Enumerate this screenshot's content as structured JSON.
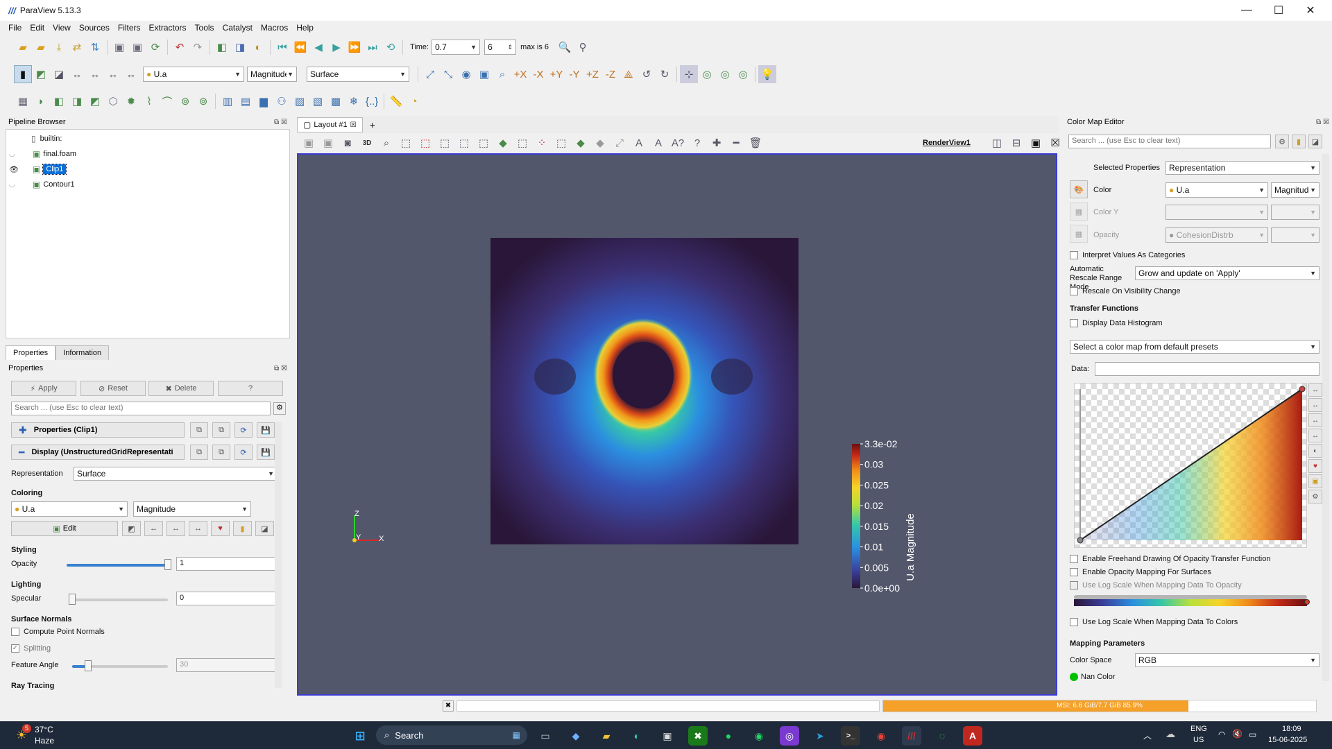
{
  "app": {
    "title": "ParaView 5.13.3",
    "logo": "paraview-logo"
  },
  "menu": [
    "File",
    "Edit",
    "View",
    "Sources",
    "Filters",
    "Extractors",
    "Tools",
    "Catalyst",
    "Macros",
    "Help"
  ],
  "toolbar": {
    "time_label": "Time:",
    "time_value": "0.7",
    "timestep_value": "6",
    "max_label": "max is 6",
    "color_array": "U.a",
    "color_component": "Magnitude",
    "representation": "Surface"
  },
  "pipeline": {
    "title": "Pipeline Browser",
    "items": [
      {
        "name": "builtin:",
        "level": 0
      },
      {
        "name": "final.foam",
        "level": 1
      },
      {
        "name": "Clip1",
        "level": 1,
        "selected": true
      },
      {
        "name": "Contour1",
        "level": 1
      }
    ]
  },
  "properties": {
    "tabs": [
      "Properties",
      "Information"
    ],
    "title": "Properties",
    "apply": "Apply",
    "reset": "Reset",
    "delete": "Delete",
    "help": "?",
    "search_placeholder": "Search ... (use Esc to clear text)",
    "group_properties": "Properties (Clip1)",
    "group_display": "Display (UnstructuredGridRepresentati",
    "representation_label": "Representation",
    "representation_value": "Surface",
    "coloring_label": "Coloring",
    "coloring_array": "U.a",
    "coloring_component": "Magnitude",
    "edit_label": "Edit",
    "styling_label": "Styling",
    "opacity_label": "Opacity",
    "opacity_value": "1",
    "opacity_level": 1.0,
    "lighting_label": "Lighting",
    "specular_label": "Specular",
    "specular_value": "0",
    "specular_level": 0.0,
    "surface_normals_label": "Surface Normals",
    "compute_normals": "Compute Point Normals",
    "splitting": "Splitting",
    "feature_angle_label": "Feature Angle",
    "feature_angle_value": "30",
    "feature_angle_level": 0.17,
    "ray_tracing_label": "Ray Tracing"
  },
  "layout": {
    "tab_label": "Layout #1",
    "add_label": "+",
    "view_name": "RenderView1",
    "mode_3d": "3D"
  },
  "scalar_bar": {
    "title": "U.a Magnitude",
    "labels": [
      "3.3e-02",
      "0.03",
      "0.025",
      "0.02",
      "0.015",
      "0.01",
      "0.005",
      "0.0e+00"
    ]
  },
  "axes": {
    "z": "Z",
    "y": "Y",
    "x": "X"
  },
  "color_map_editor": {
    "title": "Color Map Editor",
    "search_placeholder": "Search ... (use Esc to clear text)",
    "selected_props_label": "Selected Properties",
    "selected_props_value": "Representation",
    "color_label": "Color",
    "color_array": "U.a",
    "color_component": "Magnitude",
    "color_y_label": "Color Y",
    "opacity_label": "Opacity",
    "opacity_array": "CohesionDistrb",
    "interpret_categories": "Interpret Values As Categories",
    "auto_rescale_label": "Automatic Rescale Range Mode",
    "auto_rescale_value": "Grow and update on 'Apply'",
    "rescale_visibility": "Rescale On Visibility Change",
    "transfer_functions": "Transfer Functions",
    "display_histogram": "Display Data Histogram",
    "preset_placeholder": "Select a color map from default presets",
    "data_label": "Data:",
    "freehand": "Enable Freehand Drawing Of Opacity Transfer Function",
    "opacity_surfaces": "Enable Opacity Mapping For Surfaces",
    "log_opacity": "Use Log Scale When Mapping Data To Opacity",
    "log_colors": "Use Log Scale When Mapping Data To Colors",
    "mapping_params": "Mapping Parameters",
    "color_space_label": "Color Space",
    "color_space_value": "RGB",
    "nan_color_label": "Nan Color"
  },
  "status": {
    "memory": "MSI: 6.6 GiB/7.7 GiB 85.9%",
    "memory_level": 0.859
  },
  "taskbar": {
    "temp": "37°C",
    "weather": "Haze",
    "weather_badge": "5",
    "search": "Search",
    "lang1": "ENG",
    "lang2": "US",
    "time": "18:09",
    "date": "15-06-2025"
  }
}
